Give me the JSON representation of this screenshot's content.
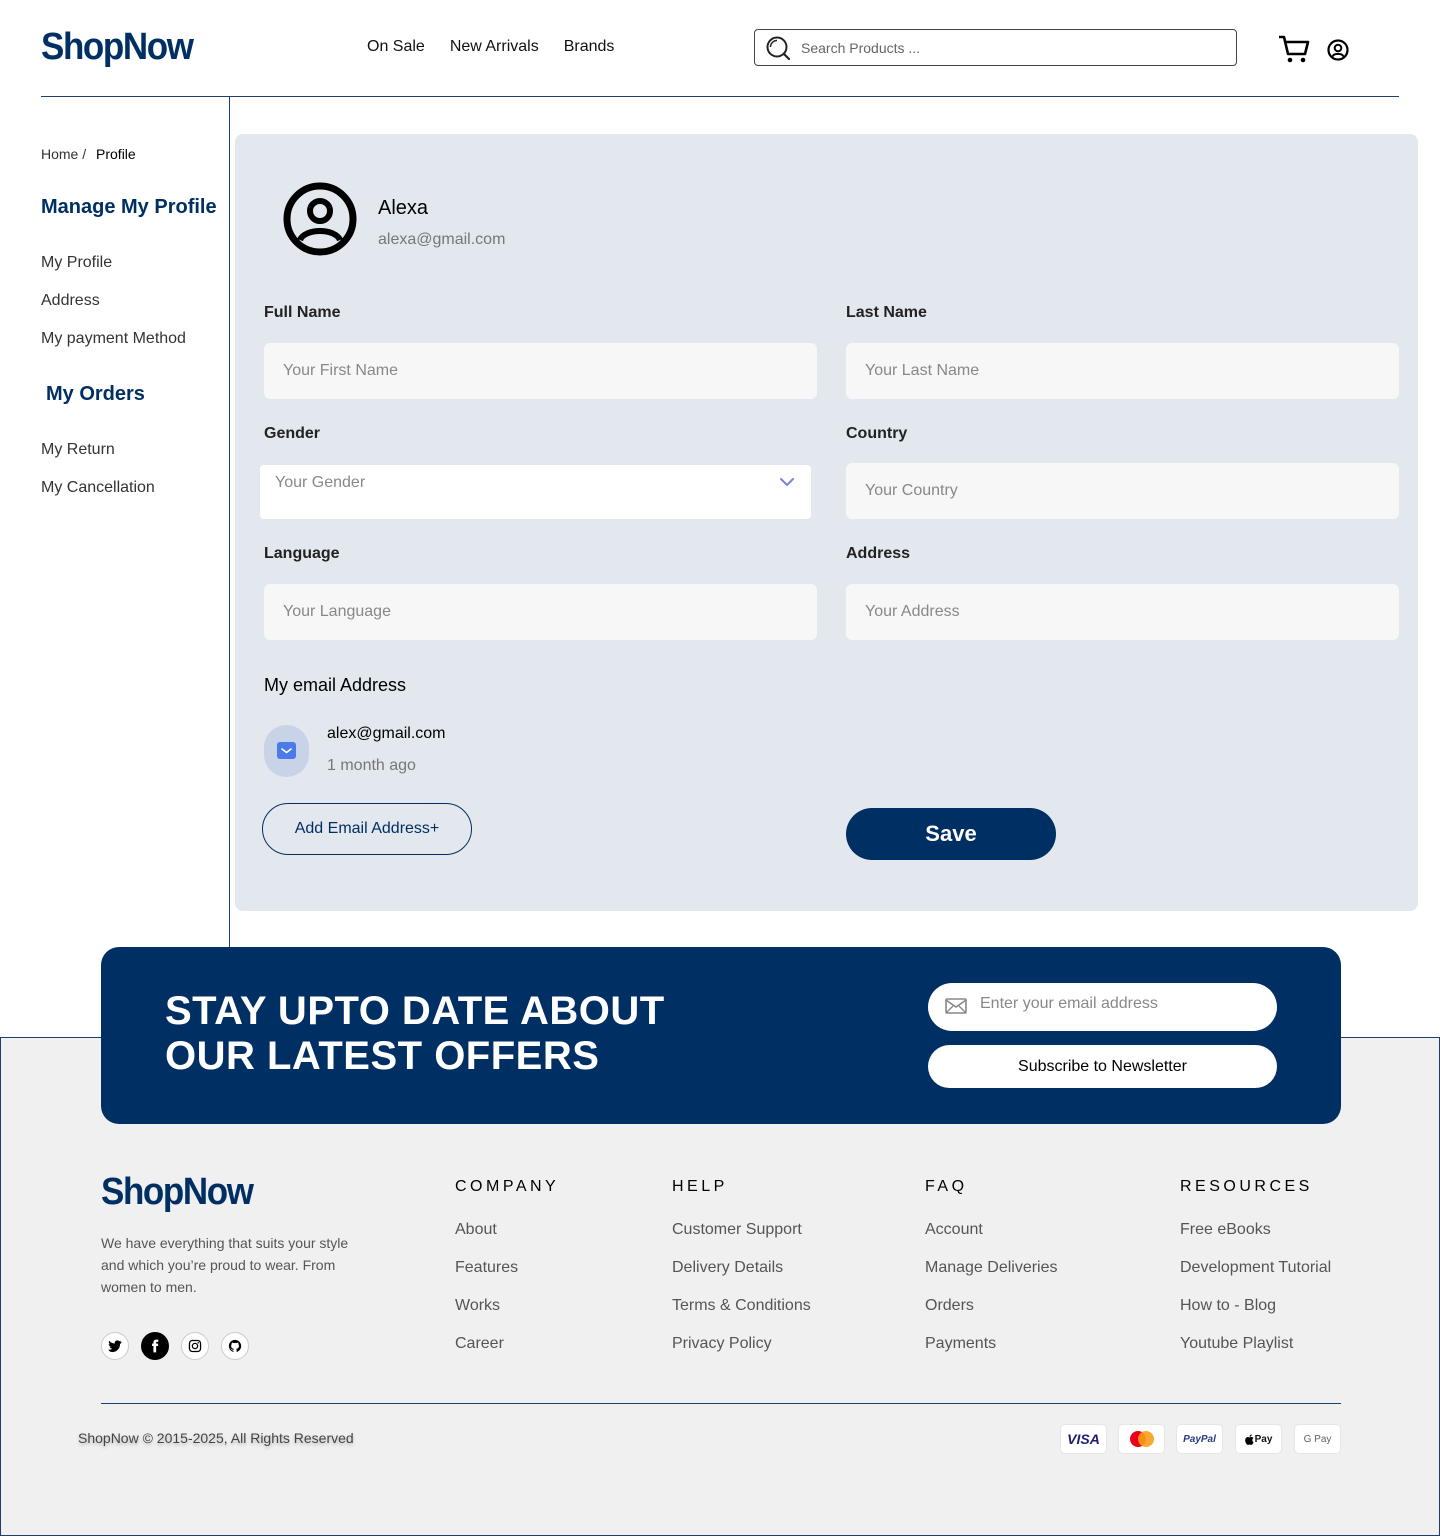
{
  "brand": {
    "logo": "ShopNow",
    "color": "#002f63"
  },
  "nav": {
    "items": [
      "On Sale",
      "New Arrivals",
      "Brands"
    ]
  },
  "search": {
    "placeholder": "Search Products ..."
  },
  "breadcrumb": {
    "home": "Home /",
    "current": "Profile"
  },
  "sidebar": {
    "manage_title": "Manage My Profile",
    "manage_items": [
      "My Profile",
      "Address",
      "My payment Method"
    ],
    "orders_title": "My Orders",
    "orders_items": [
      "My Return",
      "My Cancellation"
    ]
  },
  "profile": {
    "name": "Alexa",
    "email": "alexa@gmail.com",
    "fields": {
      "full_name": {
        "label": "Full Name",
        "placeholder": "Your First Name"
      },
      "last_name": {
        "label": "Last Name",
        "placeholder": "Your Last Name"
      },
      "gender": {
        "label": "Gender",
        "value": "Your Gender"
      },
      "country": {
        "label": "Country",
        "placeholder": "Your Country"
      },
      "language": {
        "label": "Language",
        "placeholder": "Your Language"
      },
      "address": {
        "label": "Address",
        "placeholder": "Your Address"
      }
    },
    "email_section": {
      "title": "My email Address",
      "address": "alex@gmail.com",
      "time": "1 month ago"
    },
    "add_email_label": "Add Email Address+",
    "save_label": "Save"
  },
  "newsletter": {
    "title": "STAY UPTO DATE ABOUT OUR LATEST OFFERS",
    "placeholder": "Enter your email address",
    "button": "Subscribe to Newsletter"
  },
  "footer": {
    "logo": "ShopNow",
    "description": "We have everything that suits your style and which you’re proud to wear. From women to men.",
    "social": [
      "twitter-icon",
      "facebook-icon",
      "instagram-icon",
      "github-icon"
    ],
    "columns": [
      {
        "title": "COMPANY",
        "items": [
          "About",
          "Features",
          "Works",
          "Career"
        ]
      },
      {
        "title": "HELP",
        "items": [
          "Customer Support",
          "Delivery Details",
          "Terms & Conditions",
          "Privacy Policy"
        ]
      },
      {
        "title": "FAQ",
        "items": [
          "Account",
          "Manage Deliveries",
          "Orders",
          "Payments"
        ]
      },
      {
        "title": "RESOURCES",
        "items": [
          "Free eBooks",
          "Development Tutorial",
          "How to - Blog",
          "Youtube Playlist"
        ]
      }
    ],
    "copyright": "ShopNow © 2015-2025, All Rights Reserved",
    "payments": [
      "VISA",
      "Mastercard",
      "PayPal",
      "Pay",
      "G Pay"
    ]
  }
}
